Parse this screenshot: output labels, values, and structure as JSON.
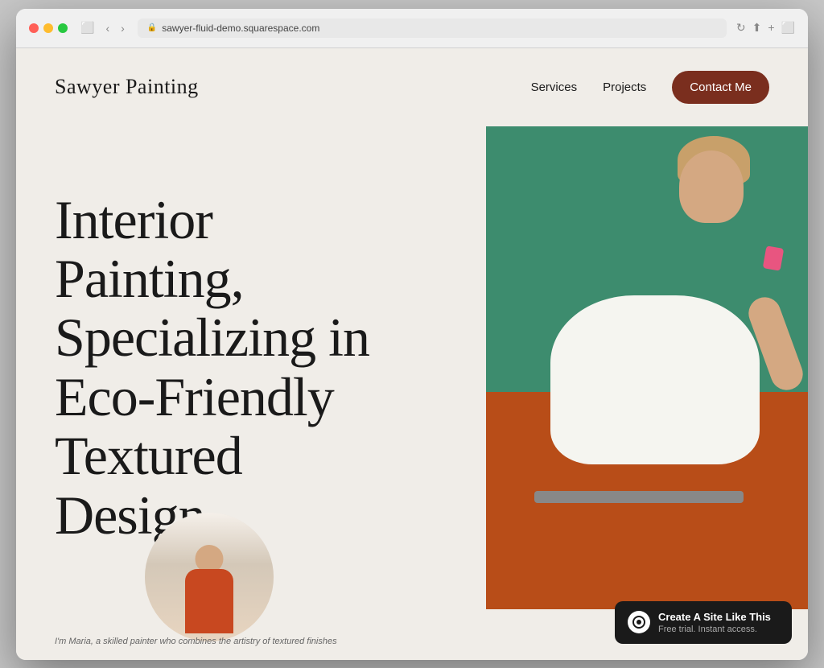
{
  "browser": {
    "url": "sawyer-fluid-demo.squarespace.com",
    "refresh_icon": "↻"
  },
  "nav": {
    "logo": "Sawyer Painting",
    "links": [
      {
        "label": "Services",
        "id": "services"
      },
      {
        "label": "Projects",
        "id": "projects"
      }
    ],
    "cta": "Contact Me"
  },
  "hero": {
    "heading": "Interior Painting, Specializing in Eco-Friendly Textured Design"
  },
  "caption": {
    "text": "I'm Maria, a skilled painter who combines the artistry of textured finishes"
  },
  "badge": {
    "title": "Create A Site Like This",
    "subtitle": "Free trial. Instant access.",
    "icon": "squarespace-icon"
  },
  "colors": {
    "background": "#f0ede8",
    "logo_text": "#1a1a1a",
    "cta_bg": "#7a2e1e",
    "heading": "#1a1a1a",
    "badge_bg": "#1a1a1a",
    "wall_green": "#3d8c6e",
    "sofa_orange": "#b84d18"
  }
}
